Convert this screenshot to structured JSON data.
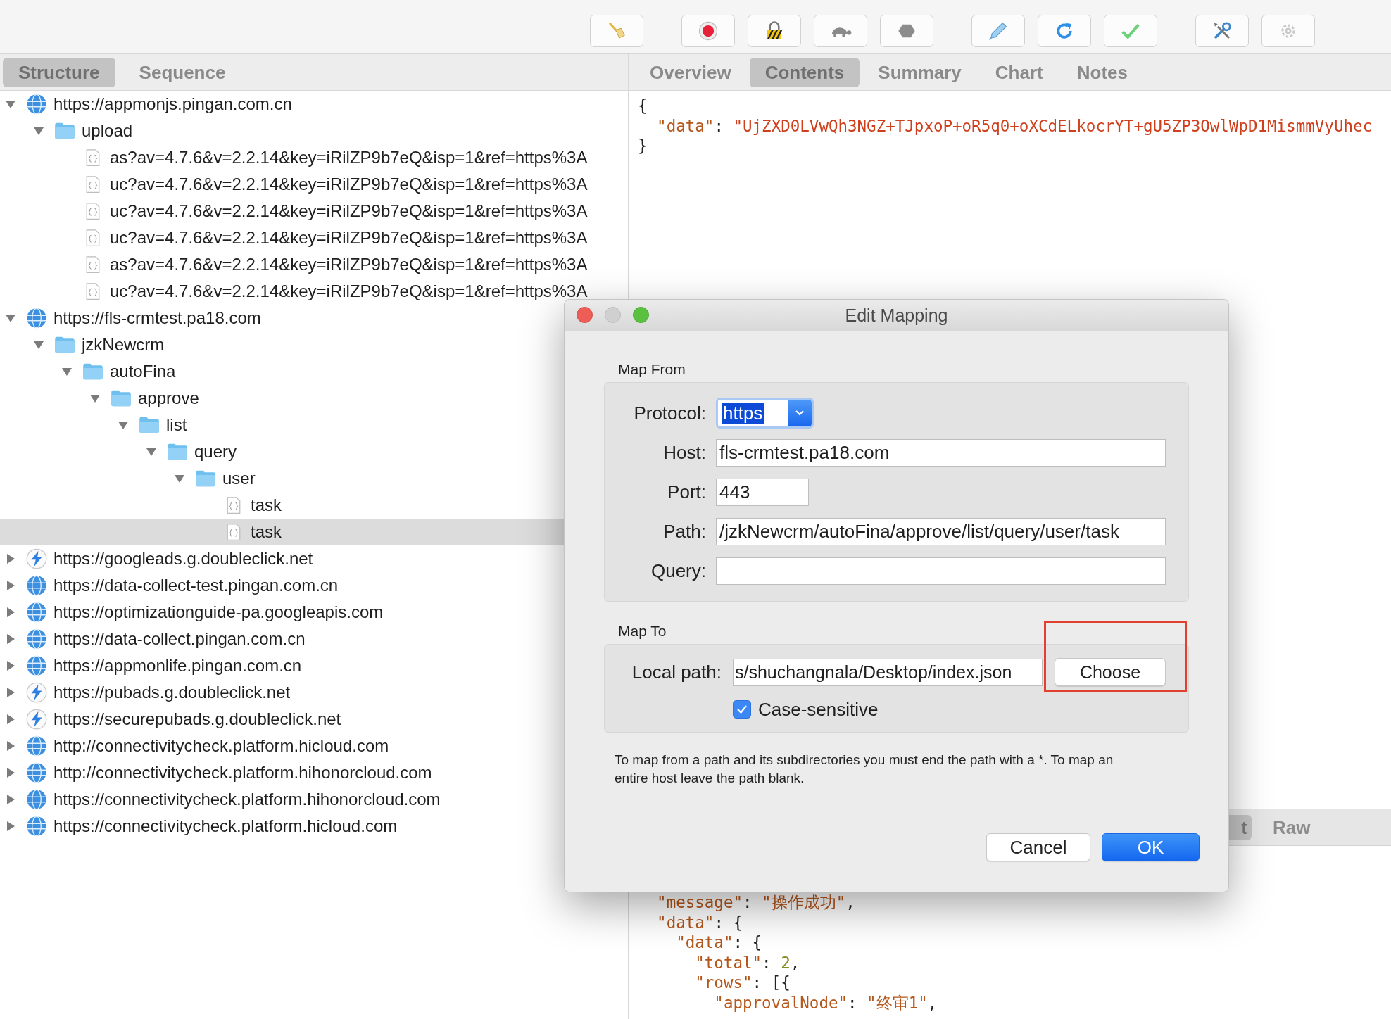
{
  "toolbar": {
    "groups": [
      [
        {
          "kind": "broom"
        }
      ],
      [
        {
          "kind": "record"
        },
        {
          "kind": "lock"
        },
        {
          "kind": "turtle"
        },
        {
          "kind": "stop"
        }
      ],
      [
        {
          "kind": "pen"
        },
        {
          "kind": "refresh"
        },
        {
          "kind": "check"
        }
      ],
      [
        {
          "kind": "tools"
        },
        {
          "kind": "gear"
        }
      ]
    ]
  },
  "left_tabs": [
    {
      "label": "Structure",
      "selected": true
    },
    {
      "label": "Sequence",
      "selected": false
    }
  ],
  "right_tabs": [
    {
      "label": "Overview",
      "selected": false
    },
    {
      "label": "Contents",
      "selected": true
    },
    {
      "label": "Summary",
      "selected": false
    },
    {
      "label": "Chart",
      "selected": false
    },
    {
      "label": "Notes",
      "selected": false
    }
  ],
  "tree": [
    {
      "label": "https://appmonjs.pingan.com.cn",
      "kind": "globe",
      "expanded": true,
      "selected": false,
      "children": [
        {
          "label": "upload",
          "kind": "folder",
          "expanded": true,
          "selected": false,
          "children": [
            {
              "label": "as?av=4.7.6&v=2.2.14&key=iRilZP9b7eQ&isp=1&ref=https%3A",
              "kind": "file",
              "selected": false
            },
            {
              "label": "uc?av=4.7.6&v=2.2.14&key=iRilZP9b7eQ&isp=1&ref=https%3A",
              "kind": "file",
              "selected": false
            },
            {
              "label": "uc?av=4.7.6&v=2.2.14&key=iRilZP9b7eQ&isp=1&ref=https%3A",
              "kind": "file",
              "selected": false
            },
            {
              "label": "uc?av=4.7.6&v=2.2.14&key=iRilZP9b7eQ&isp=1&ref=https%3A",
              "kind": "file",
              "selected": false
            },
            {
              "label": "as?av=4.7.6&v=2.2.14&key=iRilZP9b7eQ&isp=1&ref=https%3A",
              "kind": "file",
              "selected": false
            },
            {
              "label": "uc?av=4.7.6&v=2.2.14&key=iRilZP9b7eQ&isp=1&ref=https%3A",
              "kind": "file",
              "selected": false
            }
          ]
        }
      ]
    },
    {
      "label": "https://fls-crmtest.pa18.com",
      "kind": "globe",
      "expanded": true,
      "selected": false,
      "children": [
        {
          "label": "jzkNewcrm",
          "kind": "folder",
          "expanded": true,
          "selected": false,
          "children": [
            {
              "label": "autoFina",
              "kind": "folder",
              "expanded": true,
              "selected": false,
              "children": [
                {
                  "label": "approve",
                  "kind": "folder",
                  "expanded": true,
                  "selected": false,
                  "children": [
                    {
                      "label": "list",
                      "kind": "folder",
                      "expanded": true,
                      "selected": false,
                      "children": [
                        {
                          "label": "query",
                          "kind": "folder",
                          "expanded": true,
                          "selected": false,
                          "children": [
                            {
                              "label": "user",
                              "kind": "folder",
                              "expanded": true,
                              "selected": false,
                              "children": [
                                {
                                  "label": "task",
                                  "kind": "file",
                                  "selected": false
                                },
                                {
                                  "label": "task",
                                  "kind": "file",
                                  "selected": true
                                }
                              ]
                            }
                          ]
                        }
                      ]
                    }
                  ]
                }
              ]
            }
          ]
        }
      ]
    },
    {
      "label": "https://googleads.g.doubleclick.net",
      "kind": "bolt",
      "expanded": false,
      "selected": false
    },
    {
      "label": "https://data-collect-test.pingan.com.cn",
      "kind": "globe",
      "expanded": false,
      "selected": false
    },
    {
      "label": "https://optimizationguide-pa.googleapis.com",
      "kind": "globe",
      "expanded": false,
      "selected": false
    },
    {
      "label": "https://data-collect.pingan.com.cn",
      "kind": "globe",
      "expanded": false,
      "selected": false
    },
    {
      "label": "https://appmonlife.pingan.com.cn",
      "kind": "globe",
      "expanded": false,
      "selected": false
    },
    {
      "label": "https://pubads.g.doubleclick.net",
      "kind": "bolt",
      "expanded": false,
      "selected": false
    },
    {
      "label": "https://securepubads.g.doubleclick.net",
      "kind": "bolt",
      "expanded": false,
      "selected": false
    },
    {
      "label": "http://connectivitycheck.platform.hicloud.com",
      "kind": "globe",
      "expanded": false,
      "selected": false
    },
    {
      "label": "http://connectivitycheck.platform.hihonorcloud.com",
      "kind": "globe",
      "expanded": false,
      "selected": false
    },
    {
      "label": "https://connectivitycheck.platform.hihonorcloud.com",
      "kind": "globe",
      "expanded": false,
      "selected": false
    },
    {
      "label": "https://connectivitycheck.platform.hicloud.com",
      "kind": "globe",
      "expanded": false,
      "selected": false
    }
  ],
  "request_body": {
    "lines": [
      [
        {
          "kind": "punct",
          "text": "{"
        }
      ],
      [
        {
          "kind": "key",
          "text": "  \"data\""
        },
        {
          "kind": "punct",
          "text": ": "
        },
        {
          "kind": "string",
          "text": "\"UjZXD0LVwQh3NGZ+TJpxoP+oR5q0+oXCdELkocrYT+gU5ZP3OwlWpD1MismmVyUhec"
        }
      ],
      [
        {
          "kind": "punct",
          "text": "}"
        }
      ]
    ]
  },
  "response_tabs": [
    {
      "label": "t",
      "selected": true
    },
    {
      "label": "Raw",
      "selected": false
    }
  ],
  "response_body": {
    "lines": [
      [
        {
          "kind": "key",
          "text": "  \"message\""
        },
        {
          "kind": "punct",
          "text": ": "
        },
        {
          "kind": "value",
          "text": "\"操作成功\""
        },
        {
          "kind": "punct",
          "text": ","
        }
      ],
      [
        {
          "kind": "key",
          "text": "  \"data\""
        },
        {
          "kind": "punct",
          "text": ": {"
        }
      ],
      [
        {
          "kind": "key",
          "text": "    \"data\""
        },
        {
          "kind": "punct",
          "text": ": {"
        }
      ],
      [
        {
          "kind": "key",
          "text": "      \"total\""
        },
        {
          "kind": "punct",
          "text": ": "
        },
        {
          "kind": "number",
          "text": "2"
        },
        {
          "kind": "punct",
          "text": ","
        }
      ],
      [
        {
          "kind": "key",
          "text": "      \"rows\""
        },
        {
          "kind": "punct",
          "text": ": [{"
        }
      ],
      [
        {
          "kind": "key",
          "text": "        \"approvalNode\""
        },
        {
          "kind": "punct",
          "text": ": "
        },
        {
          "kind": "value",
          "text": "\"终审1\""
        },
        {
          "kind": "punct",
          "text": ","
        }
      ]
    ]
  },
  "dialog": {
    "title": "Edit Mapping",
    "map_from": {
      "heading": "Map From",
      "fields": [
        {
          "label": "Protocol:",
          "kind": "select",
          "value": "https"
        },
        {
          "label": "Host:",
          "kind": "text",
          "value": "fls-crmtest.pa18.com"
        },
        {
          "label": "Port:",
          "kind": "short",
          "value": "443"
        },
        {
          "label": "Path:",
          "kind": "text",
          "value": "/jzkNewcrm/autoFina/approve/list/query/user/task"
        },
        {
          "label": "Query:",
          "kind": "text"
        }
      ]
    },
    "map_to": {
      "heading": "Map To",
      "local_path": {
        "label": "Local path:",
        "value": "s/shuchangnala/Desktop/index.json"
      },
      "choose_button": "Choose",
      "case_sensitive": {
        "label": "Case-sensitive",
        "checked": true
      }
    },
    "note": "To map from a path and its subdirectories you must end the path with a *. To map an entire host leave the path blank.",
    "buttons": [
      {
        "label": "Cancel",
        "kind": "default"
      },
      {
        "label": "OK",
        "kind": "primary"
      }
    ]
  }
}
